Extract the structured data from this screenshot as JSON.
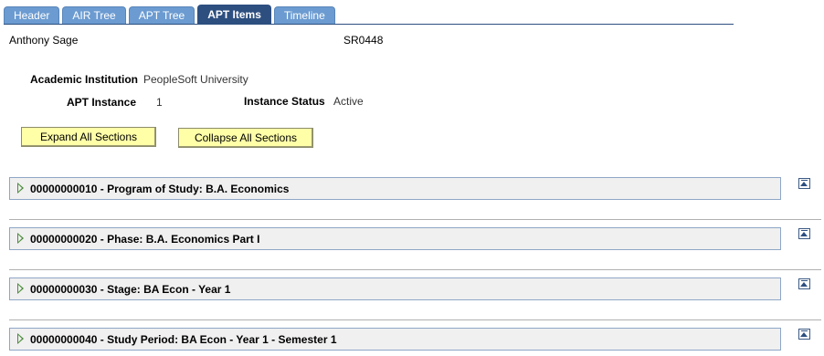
{
  "tabs": [
    {
      "label": "Header",
      "active": false
    },
    {
      "label": "AIR Tree",
      "active": false
    },
    {
      "label": "APT Tree",
      "active": false
    },
    {
      "label": "APT Items",
      "active": true
    },
    {
      "label": "Timeline",
      "active": false
    }
  ],
  "student": {
    "name": "Anthony Sage",
    "id": "SR0448"
  },
  "fields": {
    "institution_label": "Academic Institution",
    "institution_value": "PeopleSoft University",
    "apt_instance_label": "APT Instance",
    "apt_instance_value": "1",
    "status_label": "Instance Status",
    "status_value": "Active"
  },
  "buttons": {
    "expand": "Expand All Sections",
    "collapse": "Collapse All Sections"
  },
  "sections": [
    {
      "title": "00000000010 - Program of Study: B.A. Economics"
    },
    {
      "title": "00000000020 - Phase: B.A. Economics Part I"
    },
    {
      "title": "00000000030 - Stage: BA Econ - Year 1"
    },
    {
      "title": "00000000040 - Study Period: BA Econ - Year 1 - Semester 1"
    }
  ],
  "icons": {
    "expand_section": "right-triangle-icon",
    "go_top": "top-of-page-icon"
  },
  "colors": {
    "tab": "#6b9bd1",
    "tab_active": "#2d4f80",
    "button": "#ffffa8",
    "section_bg": "#f0f0f0"
  }
}
